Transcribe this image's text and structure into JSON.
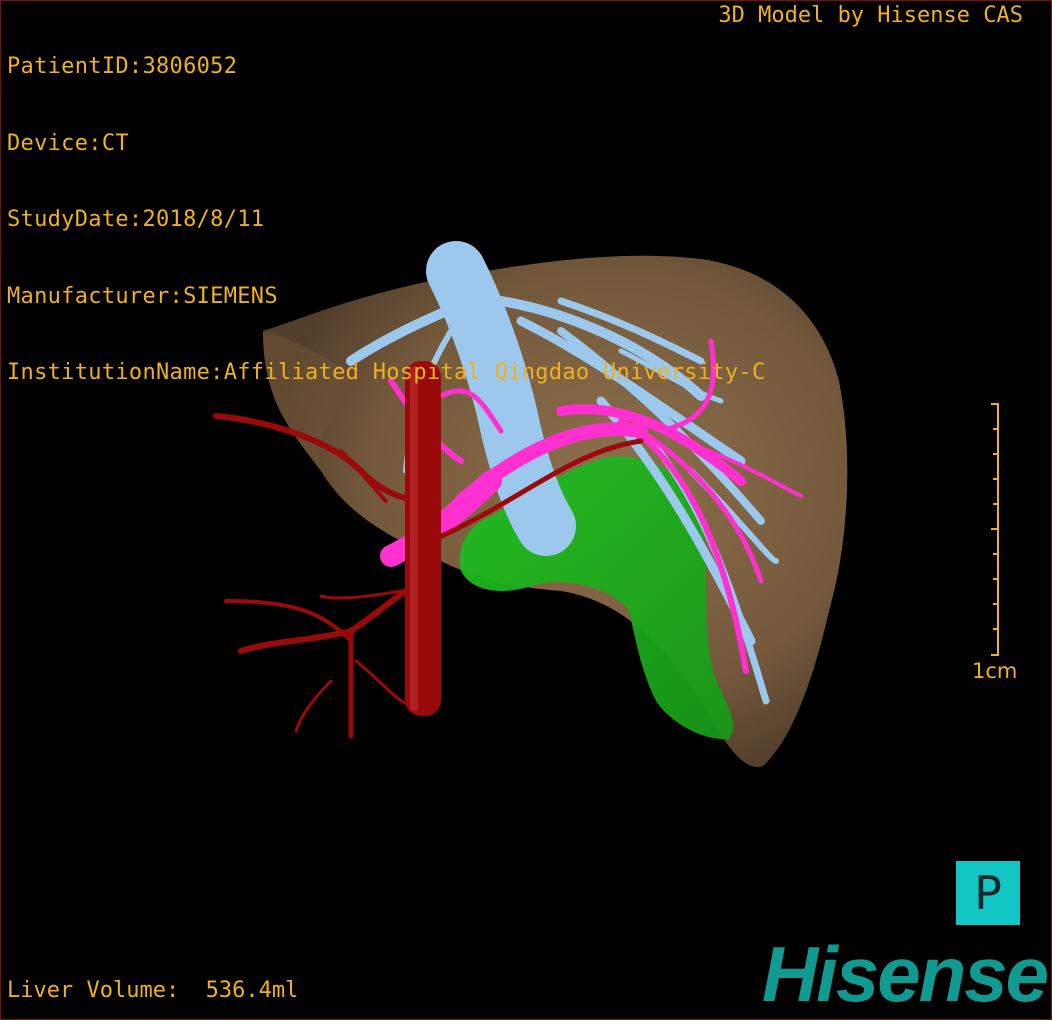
{
  "overlay": {
    "patient_id": "PatientID:3806052",
    "device": "Device:CT",
    "study_date": "StudyDate:2018/8/11",
    "manufacturer": "Manufacturer:SIEMENS",
    "institution": "InstitutionName:Affiliated Hospital Qingdao University-C",
    "credit": "3D Model by Hisense CAS",
    "liver_volume": "Liver Volume:  536.4ml",
    "scale_label": "1cm",
    "orientation_label": "P",
    "brand": "Hisense"
  },
  "colors": {
    "overlay_text": "#f0b020",
    "liver": "#8a6a45",
    "hepatic_vein": "#9cc8ee",
    "portal_vein": "#ff30d0",
    "artery": "#9a0a0a",
    "tumor": "#2ab02a",
    "orientation_box": "#12c6c6",
    "brand": "#109a92"
  },
  "structures": [
    "liver-surface",
    "hepatic-vein",
    "portal-vein",
    "hepatic-artery",
    "aorta",
    "lesion"
  ]
}
